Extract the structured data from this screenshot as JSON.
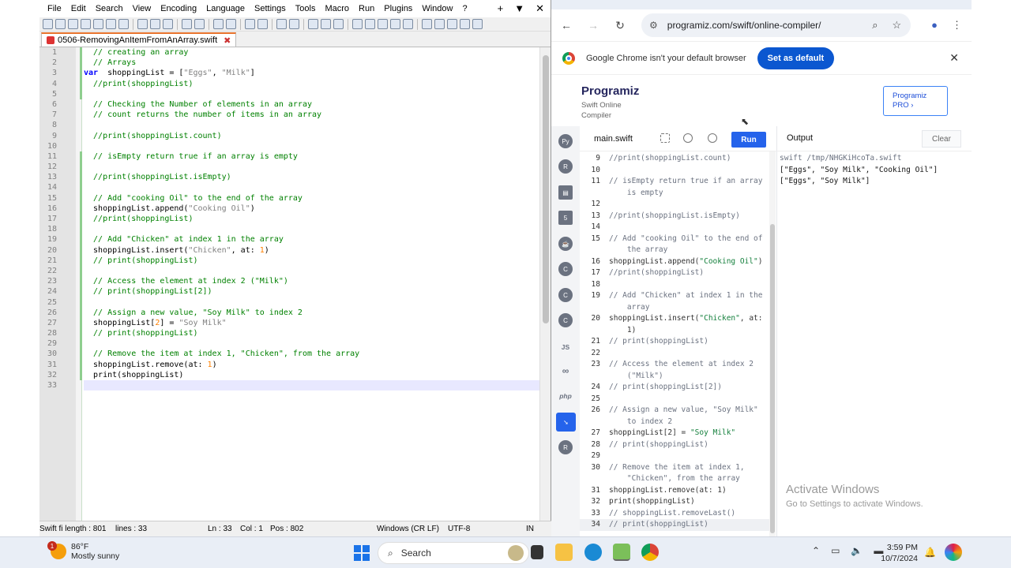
{
  "npp": {
    "menu": [
      "File",
      "Edit",
      "Search",
      "View",
      "Encoding",
      "Language",
      "Settings",
      "Tools",
      "Macro",
      "Run",
      "Plugins",
      "Window",
      "?"
    ],
    "window_controls": [
      "+",
      "▼",
      "✕"
    ],
    "tab_title": "0506-RemovingAnItemFromAnArray.swift",
    "lines": [
      [
        [
          "cmt",
          "  // creating an array"
        ]
      ],
      [
        [
          "cmt",
          "  // Arrays"
        ]
      ],
      [
        [
          "kw",
          "var"
        ],
        [
          "",
          "  shoppingList = ["
        ],
        [
          "str",
          "\"Eggs\""
        ],
        [
          "",
          ", "
        ],
        [
          "str",
          "\"Milk\""
        ],
        [
          "",
          "]"
        ]
      ],
      [
        [
          "cmt",
          "  //print(shoppingList)"
        ]
      ],
      [
        [
          "",
          ""
        ]
      ],
      [
        [
          "cmt",
          "  // Checking the Number of elements in an array"
        ]
      ],
      [
        [
          "cmt",
          "  // count returns the number of items in an array"
        ]
      ],
      [
        [
          "",
          ""
        ]
      ],
      [
        [
          "cmt",
          "  //print(shoppingList.count)"
        ]
      ],
      [
        [
          "",
          ""
        ]
      ],
      [
        [
          "cmt",
          "  // isEmpty return true if an array is empty"
        ]
      ],
      [
        [
          "",
          ""
        ]
      ],
      [
        [
          "cmt",
          "  //print(shoppingList.isEmpty)"
        ]
      ],
      [
        [
          "",
          ""
        ]
      ],
      [
        [
          "cmt",
          "  // Add \"cooking Oil\" to the end of the array"
        ]
      ],
      [
        [
          "",
          "  shoppingList.append("
        ],
        [
          "str",
          "\"Cooking Oil\""
        ],
        [
          "",
          ")"
        ]
      ],
      [
        [
          "cmt",
          "  //print(shoppingList)"
        ]
      ],
      [
        [
          "",
          ""
        ]
      ],
      [
        [
          "cmt",
          "  // Add \"Chicken\" at index 1 in the array"
        ]
      ],
      [
        [
          "",
          "  shoppingList.insert("
        ],
        [
          "str",
          "\"Chicken\""
        ],
        [
          "",
          ", at: "
        ],
        [
          "num",
          "1"
        ],
        [
          "",
          ")"
        ]
      ],
      [
        [
          "cmt",
          "  // print(shoppingList)"
        ]
      ],
      [
        [
          "",
          ""
        ]
      ],
      [
        [
          "cmt",
          "  // Access the element at index 2 (\"Milk\")"
        ]
      ],
      [
        [
          "cmt",
          "  // print(shoppingList[2])"
        ]
      ],
      [
        [
          "",
          ""
        ]
      ],
      [
        [
          "cmt",
          "  // Assign a new value, \"Soy Milk\" to index 2"
        ]
      ],
      [
        [
          "",
          "  shoppingList["
        ],
        [
          "num",
          "2"
        ],
        [
          "",
          "] = "
        ],
        [
          "str",
          "\"Soy Milk\""
        ]
      ],
      [
        [
          "cmt",
          "  // print(shoppingList)"
        ]
      ],
      [
        [
          "",
          ""
        ]
      ],
      [
        [
          "cmt",
          "  // Remove the item at index 1, \"Chicken\", from the array"
        ]
      ],
      [
        [
          "",
          "  shoppingList.remove(at: "
        ],
        [
          "num",
          "1"
        ],
        [
          "",
          ")"
        ]
      ],
      [
        [
          "",
          "  print(shoppingList)"
        ]
      ],
      [
        [
          "",
          ""
        ]
      ]
    ],
    "status": {
      "file": "Swift fi length : 801",
      "lines": "lines : 33",
      "ln": "Ln : 33",
      "col": "Col : 1",
      "pos": "Pos : 802",
      "eol": "Windows (CR LF)",
      "enc": "UTF-8",
      "mode": "IN"
    }
  },
  "chrome": {
    "url": "programiz.com/swift/online-compiler/",
    "infobar_text": "Google Chrome isn't your default browser",
    "set_default": "Set as default"
  },
  "programiz": {
    "logo": "Programiz",
    "subtitle_1": "Swift Online",
    "subtitle_2": "Compiler",
    "pro_1": "Programiz",
    "pro_2": "PRO ›",
    "file_tab": "main.swift",
    "run": "Run",
    "output_title": "Output",
    "clear": "Clear",
    "sidebar_labels": [
      "JS",
      "∞",
      "php"
    ],
    "code": [
      {
        "n": "9",
        "t": [
          [
            "pc",
            "//print(shoppingList.count)"
          ]
        ]
      },
      {
        "n": "10",
        "t": []
      },
      {
        "n": "11",
        "t": [
          [
            "pc",
            "// isEmpty return true if an array\n    is empty"
          ]
        ]
      },
      {
        "n": "12",
        "t": []
      },
      {
        "n": "13",
        "t": [
          [
            "pc",
            "//print(shoppingList.isEmpty)"
          ]
        ]
      },
      {
        "n": "14",
        "t": []
      },
      {
        "n": "15",
        "t": [
          [
            "pc",
            "// Add \"cooking Oil\" to the end of\n    the array"
          ]
        ]
      },
      {
        "n": "16",
        "t": [
          [
            "",
            "shoppingList.append("
          ],
          [
            "ps",
            "\"Cooking Oil\""
          ],
          [
            "",
            ")"
          ]
        ]
      },
      {
        "n": "17",
        "t": [
          [
            "pc",
            "//print(shoppingList)"
          ]
        ]
      },
      {
        "n": "18",
        "t": []
      },
      {
        "n": "19",
        "t": [
          [
            "pc",
            "// Add \"Chicken\" at index 1 in the\n    array"
          ]
        ]
      },
      {
        "n": "20",
        "t": [
          [
            "",
            "shoppingList.insert("
          ],
          [
            "ps",
            "\"Chicken\""
          ],
          [
            "",
            ", at:\n    1)"
          ]
        ]
      },
      {
        "n": "21",
        "t": [
          [
            "pc",
            "// print(shoppingList)"
          ]
        ]
      },
      {
        "n": "22",
        "t": []
      },
      {
        "n": "23",
        "t": [
          [
            "pc",
            "// Access the element at index 2\n    (\"Milk\")"
          ]
        ]
      },
      {
        "n": "24",
        "t": [
          [
            "pc",
            "// print(shoppingList[2])"
          ]
        ]
      },
      {
        "n": "25",
        "t": []
      },
      {
        "n": "26",
        "t": [
          [
            "pc",
            "// Assign a new value, \"Soy Milk\"\n    to index 2"
          ]
        ]
      },
      {
        "n": "27",
        "t": [
          [
            "",
            "shoppingList[2] = "
          ],
          [
            "ps",
            "\"Soy Milk\""
          ]
        ]
      },
      {
        "n": "28",
        "t": [
          [
            "pc",
            "// print(shoppingList)"
          ]
        ]
      },
      {
        "n": "29",
        "t": []
      },
      {
        "n": "30",
        "t": [
          [
            "pc",
            "// Remove the item at index 1,\n    \"Chicken\", from the array"
          ]
        ]
      },
      {
        "n": "31",
        "t": [
          [
            "",
            "shoppingList.remove(at: 1)"
          ]
        ]
      },
      {
        "n": "32",
        "t": [
          [
            "",
            "print(shoppingList)"
          ]
        ]
      },
      {
        "n": "33",
        "t": [
          [
            "pc",
            "// shoppingList.removeLast()"
          ]
        ]
      },
      {
        "n": "34",
        "t": [
          [
            "pc",
            "// print(shoppingList)"
          ]
        ]
      }
    ],
    "output": [
      "swift /tmp/NHGKiHcoTa.swift",
      "[\"Eggs\", \"Soy Milk\", \"Cooking Oil\"]",
      "[\"Eggs\", \"Soy Milk\"]"
    ],
    "activate_1": "Activate Windows",
    "activate_2": "Go to Settings to activate Windows."
  },
  "taskbar": {
    "weather_badge": "1",
    "temp": "86°F",
    "condition": "Mostly sunny",
    "search": "Search",
    "time": "3:59 PM",
    "date": "10/7/2024"
  }
}
